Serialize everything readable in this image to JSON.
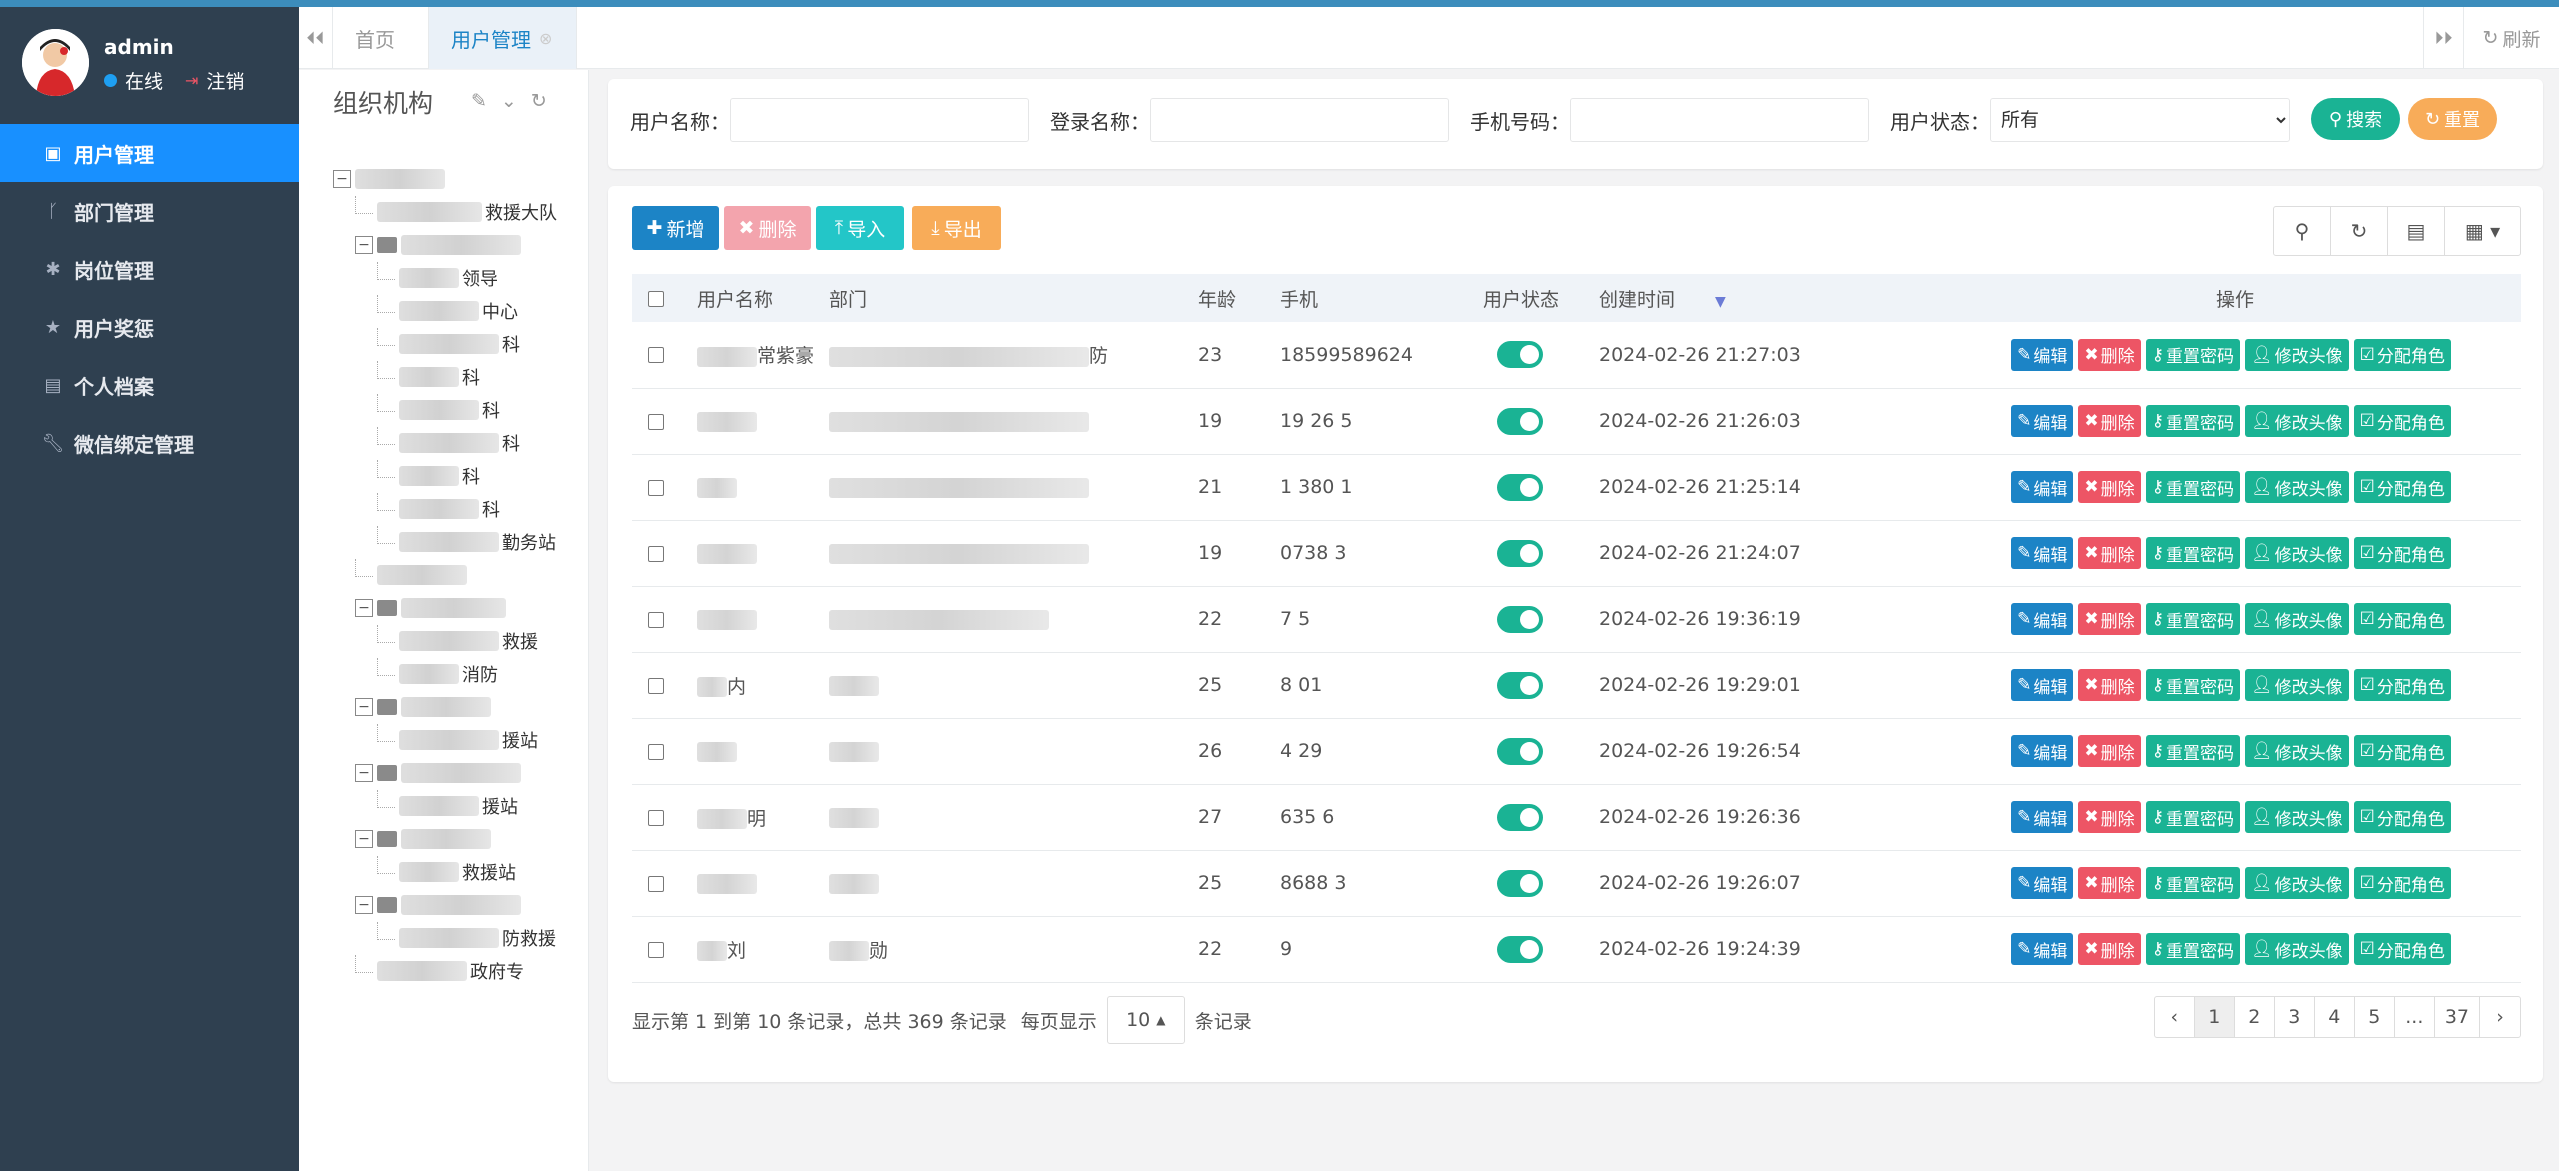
{
  "user": {
    "name": "admin",
    "status_online": "在线",
    "logout": "注销"
  },
  "menu": [
    {
      "label": "用户管理",
      "icon": "user-card-icon",
      "active": true
    },
    {
      "label": "部门管理",
      "icon": "branch-icon"
    },
    {
      "label": "岗位管理",
      "icon": "asterisk-icon"
    },
    {
      "label": "用户奖惩",
      "icon": "star-icon"
    },
    {
      "label": "个人档案",
      "icon": "id-card-icon"
    },
    {
      "label": "微信绑定管理",
      "icon": "wrench-icon"
    }
  ],
  "tabs": {
    "home": "首页",
    "current": "用户管理",
    "refresh": "刷新"
  },
  "tree": {
    "title": "组织机构",
    "nodes": [
      {
        "level": 0,
        "expander": "−",
        "text": ""
      },
      {
        "level": 1,
        "expander": "",
        "text": "救援大队"
      },
      {
        "level": 1,
        "expander": "−",
        "text": ""
      },
      {
        "level": 2,
        "expander": "",
        "text": "领导"
      },
      {
        "level": 2,
        "expander": "",
        "text": "中心"
      },
      {
        "level": 2,
        "expander": "",
        "text": "科"
      },
      {
        "level": 2,
        "expander": "",
        "text": "科"
      },
      {
        "level": 2,
        "expander": "",
        "text": "科"
      },
      {
        "level": 2,
        "expander": "",
        "text": "科"
      },
      {
        "level": 2,
        "expander": "",
        "text": "科"
      },
      {
        "level": 2,
        "expander": "",
        "text": "科"
      },
      {
        "level": 2,
        "expander": "",
        "text": "勤务站"
      },
      {
        "level": 1,
        "expander": "",
        "text": ""
      },
      {
        "level": 1,
        "expander": "−",
        "text": ""
      },
      {
        "level": 2,
        "expander": "",
        "text": "救援"
      },
      {
        "level": 2,
        "expander": "",
        "text": "消防"
      },
      {
        "level": 1,
        "expander": "−",
        "text": ""
      },
      {
        "level": 2,
        "expander": "",
        "text": "援站"
      },
      {
        "level": 1,
        "expander": "−",
        "text": ""
      },
      {
        "level": 2,
        "expander": "",
        "text": "援站"
      },
      {
        "level": 1,
        "expander": "−",
        "text": ""
      },
      {
        "level": 2,
        "expander": "",
        "text": "救援站"
      },
      {
        "level": 1,
        "expander": "−",
        "text": ""
      },
      {
        "level": 2,
        "expander": "",
        "text": "防救援"
      },
      {
        "level": 1,
        "expander": "",
        "text": "政府专"
      }
    ]
  },
  "search": {
    "username_label": "用户名称：",
    "loginname_label": "登录名称：",
    "phone_label": "手机号码：",
    "status_label": "用户状态：",
    "status_value": "所有",
    "search_btn": "搜索",
    "reset_btn": "重置"
  },
  "toolbar": {
    "add": "新增",
    "delete": "删除",
    "import": "导入",
    "export": "导出"
  },
  "table": {
    "headers": [
      "用户名称",
      "部门",
      "年龄",
      "手机",
      "用户状态",
      "创建时间",
      "操作"
    ],
    "rows": [
      {
        "name": "常紫豪",
        "dept": "防",
        "age": "23",
        "phone": "18599589624",
        "time": "2024-02-26 21:27:03"
      },
      {
        "name": "",
        "dept": "",
        "age": "19",
        "phone": "19  26  5",
        "time": "2024-02-26 21:26:03"
      },
      {
        "name": "",
        "dept": "",
        "age": "21",
        "phone": "1  380  1",
        "time": "2024-02-26 21:25:14"
      },
      {
        "name": "",
        "dept": "",
        "age": "19",
        "phone": "  0738  3",
        "time": "2024-02-26 21:24:07"
      },
      {
        "name": "",
        "dept": "",
        "age": "22",
        "phone": "  7  5",
        "time": "2024-02-26 19:36:19"
      },
      {
        "name": "内",
        "dept": "",
        "age": "25",
        "phone": "  8  01",
        "time": "2024-02-26 19:29:01"
      },
      {
        "name": "",
        "dept": "",
        "age": "26",
        "phone": "  4  29",
        "time": "2024-02-26 19:26:54"
      },
      {
        "name": "明",
        "dept": "",
        "age": "27",
        "phone": "  635  6",
        "time": "2024-02-26 19:26:36"
      },
      {
        "name": "",
        "dept": "",
        "age": "25",
        "phone": "  8688  3",
        "time": "2024-02-26 19:26:07"
      },
      {
        "name": "刘",
        "dept": "勋",
        "age": "22",
        "phone": "  9",
        "time": "2024-02-26 19:24:39"
      }
    ],
    "ops": {
      "edit": "编辑",
      "delete": "删除",
      "resetpwd": "重置密码",
      "avatar": "修改头像",
      "role": "分配角色"
    }
  },
  "footer": {
    "summary": "显示第 1 到第 10 条记录，总共 369 条记录",
    "per_page_prefix": "每页显示",
    "per_page": "10",
    "per_page_suffix": "条记录"
  },
  "pager": [
    "‹",
    "1",
    "2",
    "3",
    "4",
    "5",
    "...",
    "37",
    "›"
  ],
  "colors": {
    "sidebar": "#2f4050",
    "active": "#1890ff",
    "primary": "#1c84c6",
    "danger": "#ed5565",
    "success": "#1ab394",
    "warning": "#f8ac59"
  }
}
